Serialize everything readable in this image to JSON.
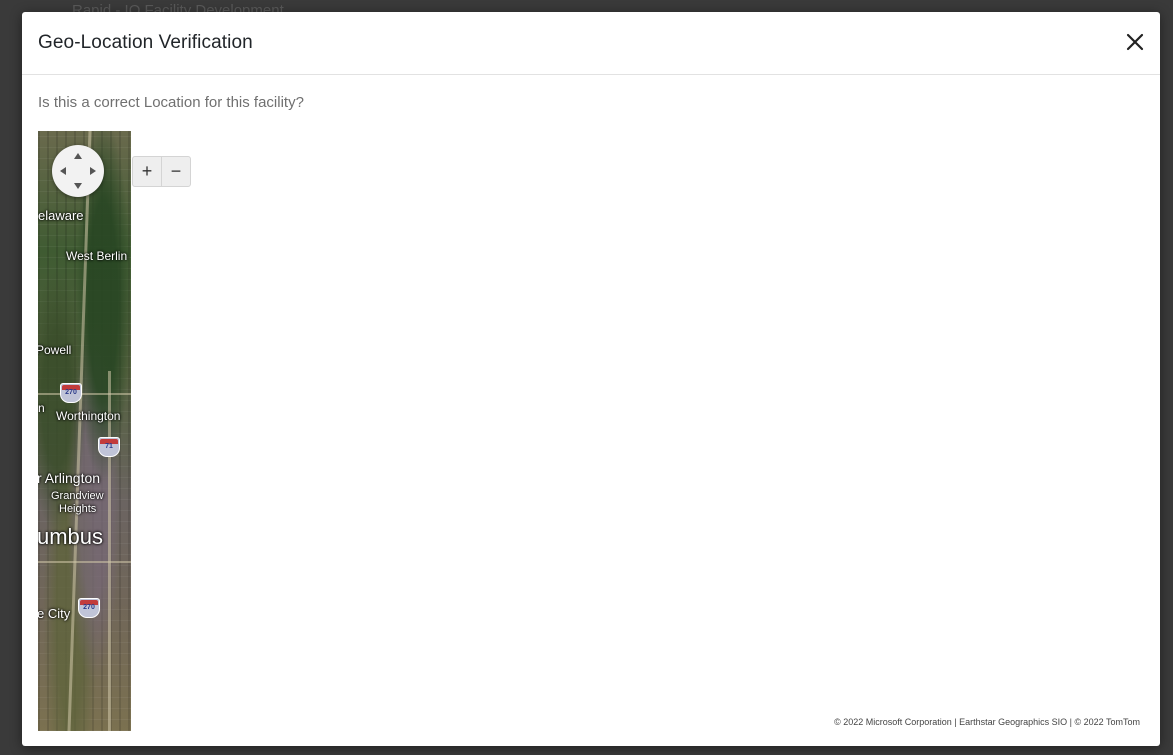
{
  "backdrop": {
    "partial_text": "Rapid - IO Facility Development"
  },
  "modal": {
    "title": "Geo-Location Verification",
    "question": "Is this a correct Location for this facility?"
  },
  "map": {
    "labels": {
      "delaware": "elaware",
      "west_berlin": "West Berlin",
      "powell": "Powell",
      "n": "n",
      "worthington": "Worthington",
      "arlington": "r Arlington",
      "grandview": "Grandview",
      "heights": "Heights",
      "columbus": "umbus",
      "city": "e City"
    },
    "shields": {
      "i270_north": "270",
      "i71": "71",
      "i270_south": "270"
    },
    "controls": {
      "zoom_in": "+",
      "zoom_out": "−"
    },
    "copyright": "© 2022 Microsoft Corporation | Earthstar Geographics SIO | © 2022 TomTom"
  },
  "icons": {
    "close": "close-icon",
    "pan": "pan-control"
  }
}
